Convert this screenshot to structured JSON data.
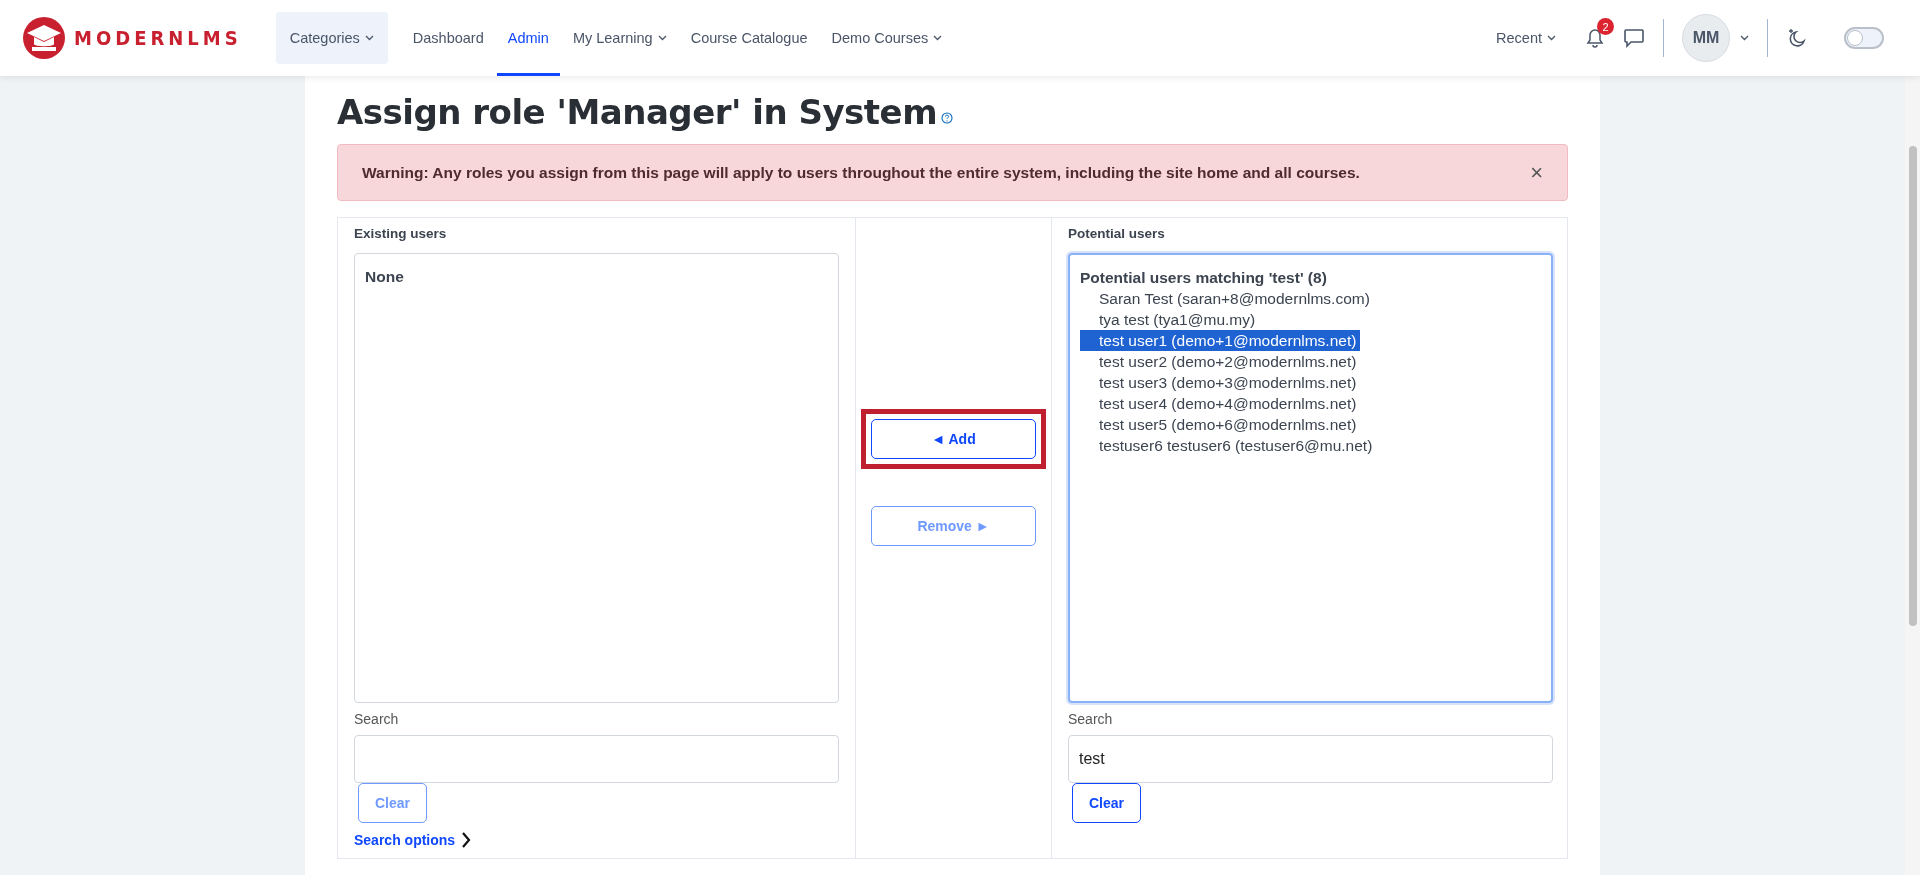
{
  "brand": {
    "name": "MODERNLMS"
  },
  "nav": [
    {
      "label": "Categories",
      "kind": "pill",
      "dropdown": true,
      "selected": false
    },
    {
      "label": "Dashboard",
      "kind": "link",
      "dropdown": false,
      "selected": false
    },
    {
      "label": "Admin",
      "kind": "link",
      "dropdown": false,
      "selected": true
    },
    {
      "label": "My Learning",
      "kind": "link",
      "dropdown": true,
      "selected": false
    },
    {
      "label": "Course Catalogue",
      "kind": "link",
      "dropdown": false,
      "selected": false
    },
    {
      "label": "Demo Courses",
      "kind": "link",
      "dropdown": true,
      "selected": false
    }
  ],
  "user_menu": {
    "recent": "Recent",
    "notification_count": "2",
    "avatar": "MM",
    "dark_mode": false
  },
  "heading": "Assign role 'Manager' in System",
  "warning": {
    "text": "Warning: Any roles you assign from this page will apply to users throughout the entire system, including the site home and all courses.",
    "close": "×"
  },
  "existing_users": {
    "label": "Existing users",
    "empty": "None",
    "search_label": "Search",
    "clear": {
      "label": "Clear",
      "disabled": true
    },
    "search_options": "Search options"
  },
  "actions": [
    {
      "label": "◄ Add",
      "disabled": false,
      "highlighted": true
    },
    {
      "label": "Remove ►",
      "disabled": true,
      "highlighted": false
    }
  ],
  "potential_users": {
    "label": "Potential users",
    "group": "Potential users matching 'test' (8)",
    "options": [
      {
        "text": "Saran Test (saran+8@modernlms.com)",
        "selected": false
      },
      {
        "text": "tya test (tya1@mu.my)",
        "selected": false
      },
      {
        "text": "test user1 (demo+1@modernlms.net)",
        "selected": true
      },
      {
        "text": "test user2 (demo+2@modernlms.net)",
        "selected": false
      },
      {
        "text": "test user3 (demo+3@modernlms.net)",
        "selected": false
      },
      {
        "text": "test user4 (demo+4@modernlms.net)",
        "selected": false
      },
      {
        "text": "test user5 (demo+6@modernlms.net)",
        "selected": false
      },
      {
        "text": "testuser6 testuser6 (testuser6@mu.net)",
        "selected": false
      }
    ],
    "search_label": "Search",
    "search_value": "test",
    "clear": {
      "label": "Clear",
      "disabled": false
    }
  }
}
